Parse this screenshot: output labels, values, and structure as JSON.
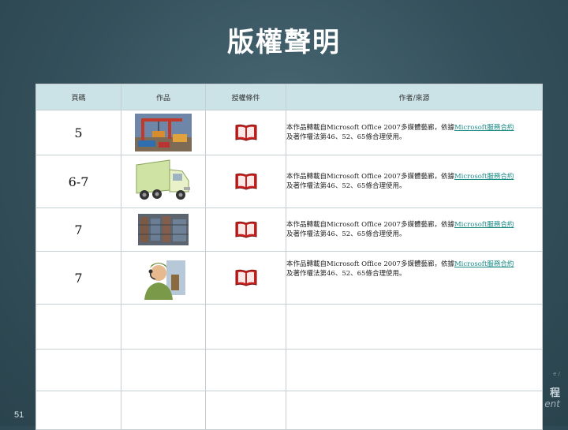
{
  "title": "版權聲明",
  "slide_number": "51",
  "corner": {
    "line_a": "程",
    "line_b": "ent",
    "line_c": "e /"
  },
  "table": {
    "headers": [
      "頁碼",
      "作品",
      "授權條件",
      "作者/來源"
    ],
    "rows": [
      {
        "page": "5",
        "image_icon": "crane-cargo-clipart",
        "license_icon": "open-book-icon",
        "source_prefix": "本作品轉載自Microsoft Office 2007多媒體藝廊，依據",
        "source_link": "Microsoft服務合約",
        "source_suffix": "及著作權法第46、52、65條合理使用。"
      },
      {
        "page": "6-7",
        "image_icon": "delivery-truck-clipart",
        "license_icon": "open-book-icon",
        "source_prefix": "本作品轉載自Microsoft Office 2007多媒體藝廊，依據",
        "source_link": "Microsoft服務合約",
        "source_suffix": "及著作權法第46、52、65條合理使用。"
      },
      {
        "page": "7",
        "image_icon": "warehouse-photo",
        "license_icon": "open-book-icon",
        "source_prefix": "本作品轉載自Microsoft Office 2007多媒體藝廊，依據",
        "source_link": "Microsoft服務合約",
        "source_suffix": "及著作權法第46、52、65條合理使用。"
      },
      {
        "page": "7",
        "image_icon": "headset-worker-clipart",
        "license_icon": "open-book-icon",
        "source_prefix": "本作品轉載自Microsoft Office 2007多媒體藝廊，依據",
        "source_link": "Microsoft服務合約",
        "source_suffix": "及著作權法第46、52、65條合理使用。"
      }
    ]
  },
  "colors": {
    "background": "#34505b",
    "header_fill": "#cbe2e6",
    "link": "#1a8a86",
    "book_red": "#c8201e"
  }
}
